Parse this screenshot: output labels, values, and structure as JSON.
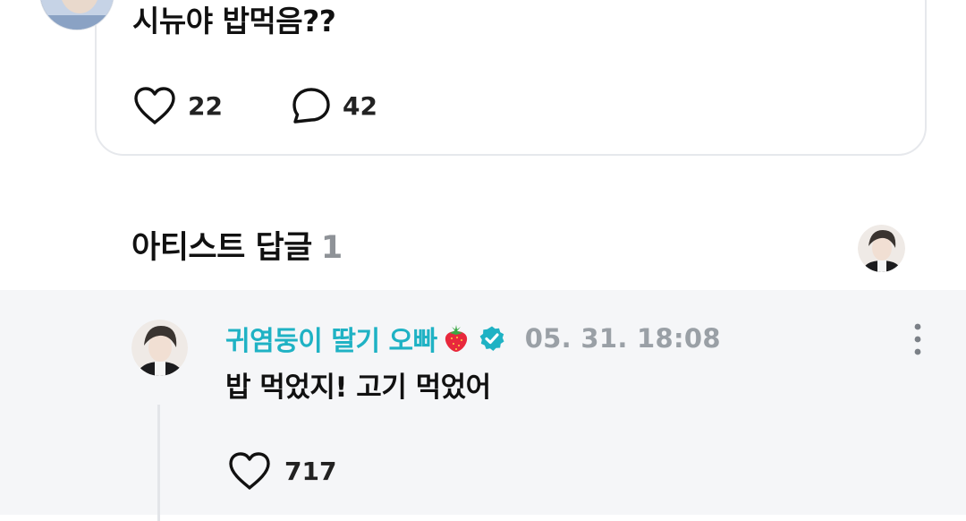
{
  "post": {
    "text": "시뉴야 밥먹음??",
    "likes": "22",
    "comments": "42"
  },
  "section": {
    "title": "아티스트 답글",
    "count": "1"
  },
  "reply": {
    "author": "귀염둥이 딸기 오빠",
    "date": "05. 31. 18:08",
    "text": "밥 먹었지! 고기 먹었어",
    "likes": "717"
  },
  "colors": {
    "accent": "#1fb2c4",
    "reply_bg": "#f5f6f8",
    "muted": "#9aa0a6"
  },
  "icons": [
    "heart-icon",
    "comment-bubble-icon",
    "strawberry-icon",
    "verified-badge-icon",
    "more-vertical-icon"
  ]
}
